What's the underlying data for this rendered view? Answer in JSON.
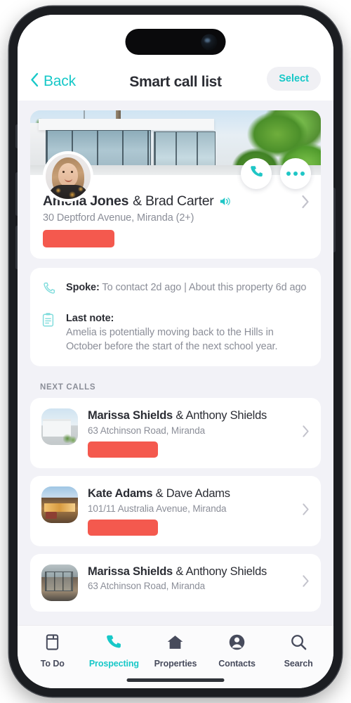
{
  "accent_color": "#17c8c8",
  "redaction_color": "#f4594e",
  "page_background": "#f2f2f7",
  "nav": {
    "back_label": "Back",
    "back_icon": "chevron-left-icon",
    "title": "Smart call list",
    "select_label": "Select"
  },
  "featured": {
    "hero_icon": "property-photo",
    "avatar_icon": "contact-avatar-photo",
    "call_icon": "phone-icon",
    "more_icon": "ellipsis-icon",
    "primary_name": "Amelia Jones",
    "secondary_name": "& Brad Carter",
    "speaker_icon": "speaker-icon",
    "address": "30 Deptford Avenue, Miranda (2+)",
    "badge_redacted": true,
    "chevron_icon": "chevron-right-icon"
  },
  "activity": {
    "spoke": {
      "icon": "phone-outline-icon",
      "label": "Spoke:",
      "value": "To contact 2d ago  |  About this property 6d ago"
    },
    "note": {
      "icon": "note-clipboard-icon",
      "label": "Last note:",
      "body": "Amelia is potentially moving back to the Hills in October before the start of the next school year."
    }
  },
  "next_calls": {
    "header": "NEXT CALLS",
    "items": [
      {
        "thumb_icon": "property-thumbnail",
        "primary_name": "Marissa Shields",
        "secondary_name": "& Anthony Shields",
        "address": "63 Atchinson Road,  Miranda",
        "badge_redacted": true,
        "chevron_icon": "chevron-right-icon"
      },
      {
        "thumb_icon": "property-thumbnail",
        "primary_name": "Kate Adams",
        "secondary_name": "& Dave Adams",
        "address": "101/11 Australia Avenue,  Miranda",
        "badge_redacted": true,
        "chevron_icon": "chevron-right-icon"
      },
      {
        "thumb_icon": "property-thumbnail",
        "primary_name": "Marissa Shields",
        "secondary_name": "& Anthony Shields",
        "address": "63 Atchinson Road,  Miranda",
        "badge_redacted": false,
        "chevron_icon": "chevron-right-icon"
      }
    ]
  },
  "tabs": [
    {
      "label": "To Do",
      "icon": "todo-list-icon",
      "active": false
    },
    {
      "label": "Prospecting",
      "icon": "phone-icon",
      "active": true
    },
    {
      "label": "Properties",
      "icon": "home-icon",
      "active": false
    },
    {
      "label": "Contacts",
      "icon": "person-icon",
      "active": false
    },
    {
      "label": "Search",
      "icon": "search-icon",
      "active": false
    }
  ]
}
